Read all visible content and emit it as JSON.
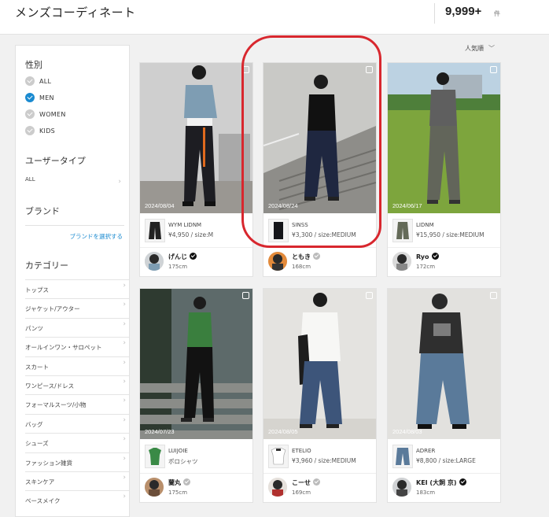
{
  "header": {
    "title": "メンズコーディネート",
    "count": "9,999+",
    "count_unit": "件"
  },
  "sort": {
    "label": "人気順"
  },
  "sidebar": {
    "gender_title": "性別",
    "genders": [
      {
        "label": "ALL",
        "checked": false
      },
      {
        "label": "MEN",
        "checked": true
      },
      {
        "label": "WOMEN",
        "checked": false
      },
      {
        "label": "KIDS",
        "checked": false
      }
    ],
    "user_type_title": "ユーザータイプ",
    "user_type_value": "ALL",
    "brand_title": "ブランド",
    "brand_link": "ブランドを選択する",
    "category_title": "カテゴリー",
    "categories": [
      "トップス",
      "ジャケット/アウター",
      "パンツ",
      "オールインワン・サロペット",
      "スカート",
      "ワンピース/ドレス",
      "フォーマルスーツ/小物",
      "バッグ",
      "シューズ",
      "ファッション雑貨",
      "スキンケア",
      "ベースメイク"
    ]
  },
  "cards": [
    {
      "date": "2024/08/04",
      "brand": "WYM LIDNM",
      "price": "¥4,950 / size:M",
      "user": "げんじ",
      "verified": true,
      "height": "175cm"
    },
    {
      "date": "2024/08/24",
      "brand": "SINSS",
      "price": "¥3,300 / size:MEDIUM",
      "user": "ともき",
      "verified": false,
      "height": "168cm"
    },
    {
      "date": "2024/06/17",
      "brand": "LIDNM",
      "price": "¥15,950 / size:MEDIUM",
      "user": "Ryo",
      "verified": true,
      "height": "172cm"
    },
    {
      "date": "2024/07/23",
      "brand": "LUIJOIE",
      "price": "ポロシャツ",
      "user": "蘭丸",
      "verified": false,
      "height": "175cm"
    },
    {
      "date": "2024/08/05",
      "brand": "ETELIO",
      "price": "¥3,960 / size:MEDIUM",
      "user": "こーせ",
      "verified": false,
      "height": "169cm"
    },
    {
      "date": "2024/08/03",
      "brand": "ADRER",
      "price": "¥8,800 / size:LARGE",
      "user": "KEI (大飼 京)",
      "verified": true,
      "height": "183cm"
    }
  ],
  "colors": {
    "accent": "#1a8ad0",
    "highlight": "#d8272e"
  }
}
